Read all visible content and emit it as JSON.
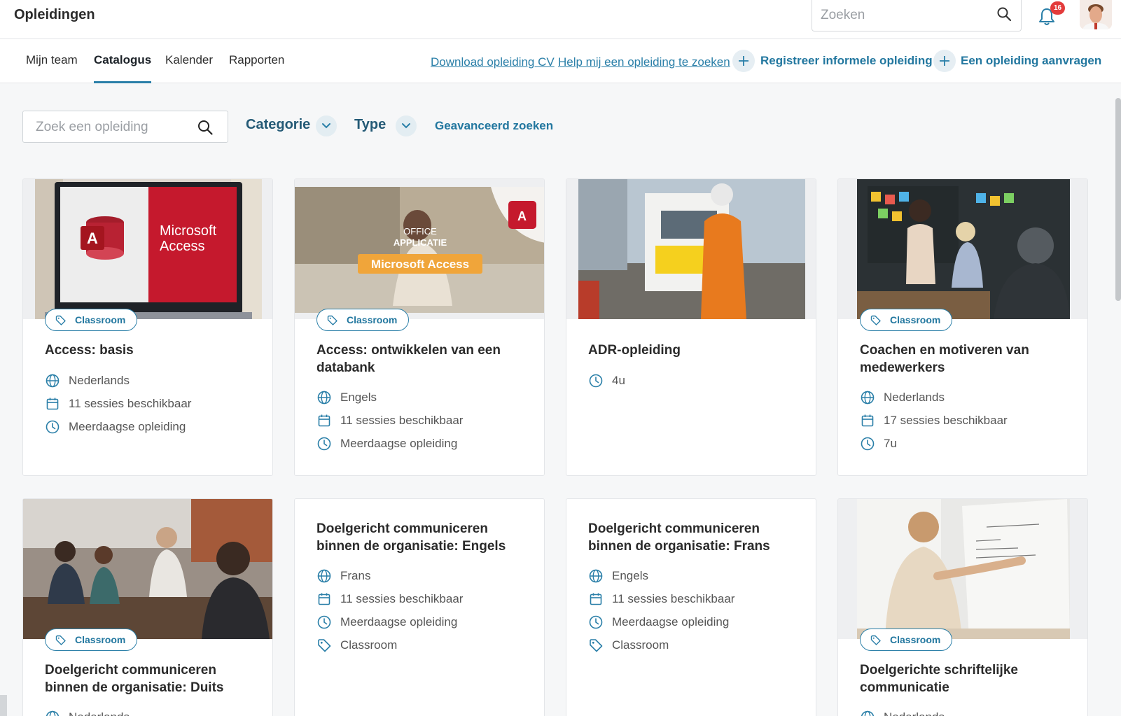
{
  "app": {
    "title": "Opleidingen"
  },
  "global_search": {
    "placeholder": "Zoeken"
  },
  "notifications": {
    "count": "16"
  },
  "tabs": [
    {
      "label": "Mijn team"
    },
    {
      "label": "Catalogus",
      "active": true
    },
    {
      "label": "Kalender"
    },
    {
      "label": "Rapporten"
    }
  ],
  "nav_links": {
    "download_cv": "Download opleiding CV",
    "help_search": "Help mij een opleiding te zoeken",
    "register_informal": "Registreer informele opleiding",
    "request_training": "Een opleiding aanvragen"
  },
  "filters": {
    "search_placeholder": "Zoek een opleiding",
    "category": "Categorie",
    "type": "Type",
    "advanced": "Geavanceerd zoeken"
  },
  "colors": {
    "accent": "#22779f",
    "filter_text": "#245a76",
    "badge": "#e33b3b",
    "access_red": "#c5192d"
  },
  "cards": [
    {
      "title": "Access: basis",
      "tag": "Classroom",
      "image": "microsoft-access-laptop",
      "meta": [
        {
          "icon": "globe-icon",
          "text": "Nederlands"
        },
        {
          "icon": "calendar-icon",
          "text": "11 sessies beschikbaar"
        },
        {
          "icon": "clock-icon",
          "text": "Meerdaagse opleiding"
        }
      ]
    },
    {
      "title": "Access: ontwikkelen van een databank",
      "tag": "Classroom",
      "image": "office-applicatie-access",
      "meta": [
        {
          "icon": "globe-icon",
          "text": "Engels"
        },
        {
          "icon": "calendar-icon",
          "text": "11 sessies beschikbaar"
        },
        {
          "icon": "clock-icon",
          "text": "Meerdaagse opleiding"
        }
      ]
    },
    {
      "title": "ADR-opleiding",
      "tag": "",
      "image": "truck-worker",
      "meta": [
        {
          "icon": "clock-icon",
          "text": "4u"
        }
      ]
    },
    {
      "title": "Coachen en motiveren van medewerkers",
      "tag": "Classroom",
      "image": "presentation-meeting",
      "meta": [
        {
          "icon": "globe-icon",
          "text": "Nederlands"
        },
        {
          "icon": "calendar-icon",
          "text": "17 sessies beschikbaar"
        },
        {
          "icon": "clock-icon",
          "text": "7u"
        }
      ]
    },
    {
      "title": "Doelgericht communiceren binnen de organisatie: Duits",
      "tag": "Classroom",
      "image": "team-meeting-table",
      "meta": [
        {
          "icon": "globe-icon",
          "text": "Nederlands"
        }
      ]
    },
    {
      "title": "Doelgericht communiceren binnen de organisatie: Engels",
      "tag": "",
      "image": "",
      "meta": [
        {
          "icon": "globe-icon",
          "text": "Frans"
        },
        {
          "icon": "calendar-icon",
          "text": "11 sessies beschikbaar"
        },
        {
          "icon": "clock-icon",
          "text": "Meerdaagse opleiding"
        },
        {
          "icon": "tag-icon",
          "text": "Classroom"
        }
      ]
    },
    {
      "title": "Doelgericht communiceren binnen de organisatie: Frans",
      "tag": "",
      "image": "",
      "meta": [
        {
          "icon": "globe-icon",
          "text": "Engels"
        },
        {
          "icon": "calendar-icon",
          "text": "11 sessies beschikbaar"
        },
        {
          "icon": "clock-icon",
          "text": "Meerdaagse opleiding"
        },
        {
          "icon": "tag-icon",
          "text": "Classroom"
        }
      ]
    },
    {
      "title": "Doelgerichte schriftelijke communicatie",
      "tag": "Classroom",
      "image": "woman-flipchart",
      "meta": [
        {
          "icon": "globe-icon",
          "text": "Nederlands"
        }
      ]
    }
  ],
  "image_text": {
    "access_logo_letter": "A",
    "access_brand_line1": "Microsoft",
    "access_brand_line2": "Access",
    "office_line1": "OFFICE",
    "office_line2": "APPLICATIE",
    "office_banner": "Microsoft Access"
  }
}
